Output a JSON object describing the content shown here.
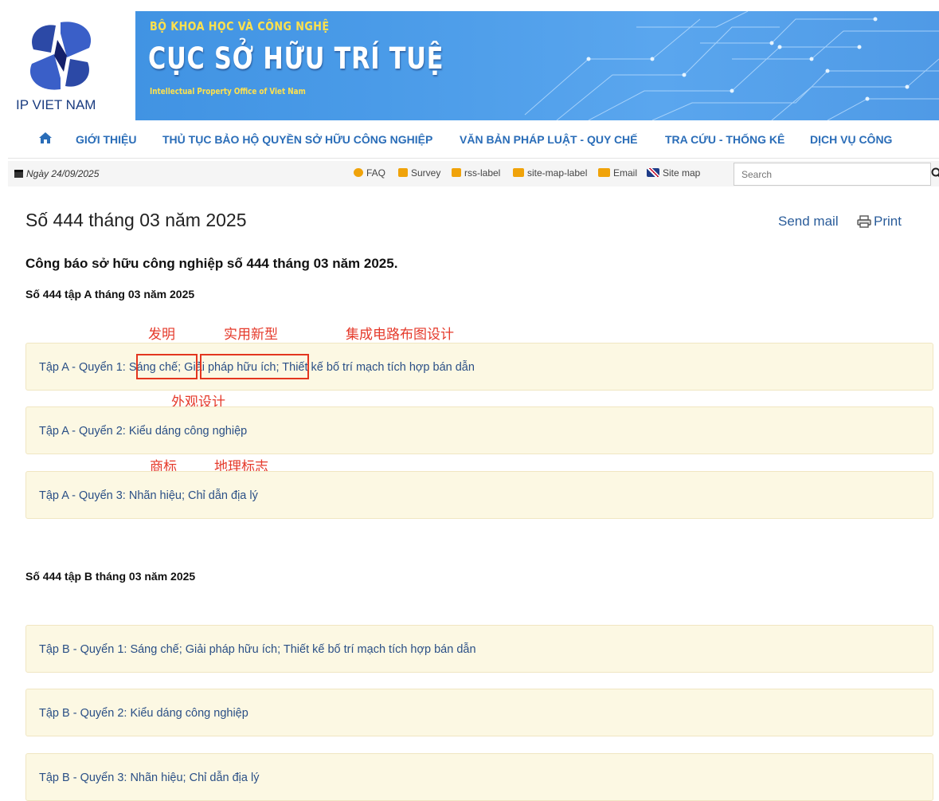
{
  "header": {
    "logo_text": "IP VIET NAM",
    "ministry": "BỘ KHOA HỌC VÀ CÔNG NGHỆ",
    "agency": "CỤC SỞ HỮU TRÍ TUỆ",
    "agency_en": "Intellectual Property Office of Viet Nam"
  },
  "nav": {
    "items": [
      {
        "label": "GIỚI THIỆU"
      },
      {
        "label": "THỦ TỤC BẢO HỘ QUYỀN SỞ HỮU CÔNG NGHIỆP"
      },
      {
        "label": "VĂN BẢN PHÁP LUẬT - QUY CHẾ"
      },
      {
        "label": "TRA CỨU - THỐNG KÊ"
      },
      {
        "label": "DỊCH VỤ CÔNG"
      }
    ]
  },
  "utility": {
    "date": "Ngày 24/09/2025",
    "links": [
      {
        "label": "FAQ",
        "icon": "chat-icon",
        "color": "#f0a30a"
      },
      {
        "label": "Survey",
        "icon": "check-square-icon",
        "color": "#f0a30a"
      },
      {
        "label": "rss-label",
        "icon": "rss-icon",
        "color": "#f0a30a"
      },
      {
        "label": "site-map-label",
        "icon": "sitemap-icon",
        "color": "#f0a30a"
      },
      {
        "label": "Email",
        "icon": "envelope-icon",
        "color": "#f0a30a"
      },
      {
        "label": "Site map",
        "icon": "uk-flag-icon",
        "color": "#1f3c88"
      }
    ],
    "search_placeholder": "Search"
  },
  "article": {
    "title": "Số 444 tháng 03 năm 2025",
    "send_mail": "Send mail",
    "print": "Print",
    "subtitle": "Công báo sở hữu công nghiệp số 444 tháng 03 năm 2025.",
    "section_a": "Số 444 tập A tháng 03 năm 2025",
    "section_b": "Số 444 tập B tháng 03 năm 2025",
    "volumes_a": [
      {
        "label": "Tập A - Quyển 1: Sáng chế; Giải pháp hữu ích; Thiết kế bố trí mạch tích hợp bán dẫn"
      },
      {
        "label": "Tập A - Quyển 2: Kiểu dáng công nghiệp"
      },
      {
        "label": "Tập A - Quyển 3: Nhãn hiệu; Chỉ dẫn địa lý"
      }
    ],
    "volumes_b": [
      {
        "label": "Tập B - Quyển 1: Sáng chế; Giải pháp hữu ích; Thiết kế bố trí mạch tích hợp bán dẫn"
      },
      {
        "label": "Tập B - Quyển 2: Kiểu dáng công nghiệp"
      },
      {
        "label": "Tập B - Quyển 3: Nhãn hiệu; Chỉ dẫn địa lý"
      }
    ]
  },
  "annotations": {
    "invention": "发明",
    "utility_model": "实用新型",
    "ic_layout": "集成电路布图设计",
    "design": "外观设计",
    "trademark": "商标",
    "geo_indication": "地理标志",
    "color": "#e53a2b"
  }
}
